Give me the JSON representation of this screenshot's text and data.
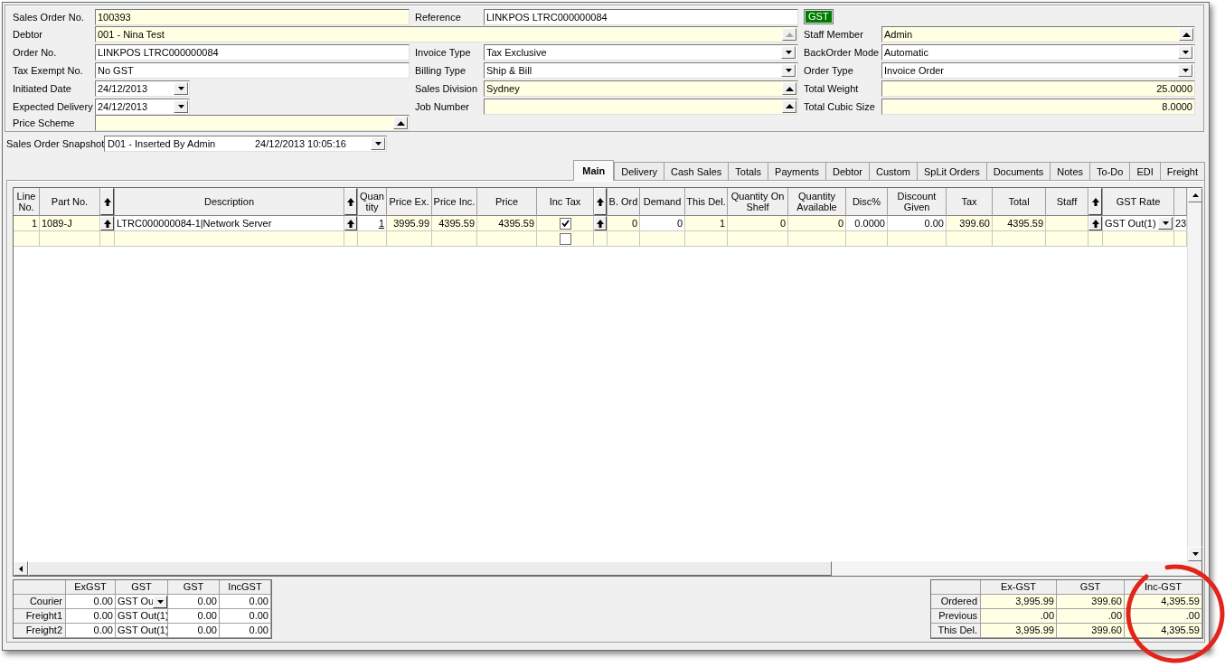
{
  "order_form": {
    "rows": [
      {
        "left": {
          "label": "Sales Order No.",
          "value": "100393",
          "kind": "text",
          "readonly": true
        },
        "middle": {
          "label": "Reference",
          "value": "LINKPOS LTRC000000084",
          "kind": "text",
          "readonly": false
        },
        "right": {
          "label": "GST",
          "kind": "badge"
        }
      },
      {
        "left": {
          "label": "Debtor",
          "value": "001 - Nina Test",
          "kind": "lookup",
          "readonly": true,
          "disabled": true
        },
        "right": {
          "label": "Staff Member",
          "value": "Admin",
          "kind": "lookup",
          "readonly": true,
          "disabled": false
        }
      },
      {
        "left": {
          "label": "Order No.",
          "value": "LINKPOS LTRC000000084",
          "kind": "text",
          "readonly": false
        },
        "middle": {
          "label": "Invoice Type",
          "value": "Tax Exclusive",
          "kind": "combo",
          "readonly": false
        },
        "right": {
          "label": "BackOrder Mode",
          "value": "Automatic",
          "kind": "combo",
          "readonly": false
        }
      },
      {
        "left": {
          "label": "Tax Exempt No.",
          "value": "No GST",
          "kind": "text",
          "readonly": false
        },
        "middle": {
          "label": "Billing Type",
          "value": "Ship & Bill",
          "kind": "combo",
          "readonly": false
        },
        "right": {
          "label": "Order Type",
          "value": "Invoice Order",
          "kind": "combo",
          "readonly": false
        }
      },
      {
        "left": {
          "label": "Initiated Date",
          "value": "24/12/2013",
          "kind": "date",
          "readonly": false
        },
        "middle": {
          "label": "Sales Division",
          "value": "Sydney",
          "kind": "lookup",
          "readonly": true,
          "disabled": false
        },
        "right": {
          "label": "Total Weight",
          "value": "25.0000",
          "kind": "number",
          "readonly": true
        }
      },
      {
        "left": {
          "label": "Expected Delivery",
          "value": "24/12/2013",
          "kind": "date",
          "readonly": false
        },
        "middle": {
          "label": "Job Number",
          "kind": "lookup",
          "readonly": true,
          "disabled": false
        },
        "right": {
          "label": "Total Cubic Size",
          "value": "8.0000",
          "kind": "number",
          "readonly": true
        }
      },
      {
        "left": {
          "label": "Price Scheme",
          "kind": "lookup",
          "readonly": true,
          "disabled": false
        }
      }
    ]
  },
  "snapshot": {
    "label": "Sales Order Snapshot",
    "value": "D01 - Inserted By Admin",
    "timestamp": "24/12/2013 10:05:16"
  },
  "tabs": [
    {
      "label": "Main",
      "selected": true
    },
    {
      "label": "Delivery",
      "selected": false
    },
    {
      "label": "Cash Sales",
      "selected": false
    },
    {
      "label": "Totals",
      "selected": false
    },
    {
      "label": "Payments",
      "selected": false
    },
    {
      "label": "Debtor",
      "selected": false
    },
    {
      "label": "Custom",
      "selected": false
    },
    {
      "label": "SpLit Orders",
      "selected": false
    },
    {
      "label": "Documents",
      "selected": false
    },
    {
      "label": "Notes",
      "selected": false
    },
    {
      "label": "To-Do",
      "selected": false
    },
    {
      "label": "EDI",
      "selected": false
    },
    {
      "label": "Freight",
      "selected": false
    }
  ],
  "order_lines": {
    "columns": [
      {
        "label": "Line No.",
        "kind": "number",
        "editable": false,
        "cells": [
          "1"
        ]
      },
      {
        "label": "Part No.",
        "kind": "text",
        "editable": false,
        "cells": [
          "1089-J"
        ]
      },
      {
        "kind": "button"
      },
      {
        "label": "Description",
        "kind": "text",
        "editable": true,
        "cells": [
          "LTRC000000084-1|Network Server"
        ]
      },
      {
        "kind": "button"
      },
      {
        "label": "Quantity",
        "kind": "link",
        "editable": true,
        "cells": [
          "1"
        ]
      },
      {
        "label": "Price Ex.",
        "kind": "number",
        "editable": false,
        "cells": [
          "3995.99"
        ]
      },
      {
        "label": "Price Inc.",
        "kind": "number",
        "editable": false,
        "cells": [
          "4395.59"
        ]
      },
      {
        "label": "Price",
        "kind": "number",
        "editable": false,
        "cells": [
          "4395.59"
        ]
      },
      {
        "label": "Inc Tax",
        "kind": "check",
        "editable": false
      },
      {
        "kind": "button"
      },
      {
        "label": "B. Ord",
        "kind": "number",
        "editable": false,
        "cells": [
          "0"
        ]
      },
      {
        "label": "Demand",
        "kind": "number",
        "editable": true,
        "cells": [
          "0"
        ]
      },
      {
        "label": "This Del.",
        "kind": "number",
        "editable": false,
        "cells": [
          "1"
        ]
      },
      {
        "label": "Quantity On Shelf",
        "kind": "number",
        "editable": false,
        "cells": [
          "0"
        ]
      },
      {
        "label": "Quantity Available",
        "kind": "number",
        "editable": false,
        "cells": [
          "0"
        ]
      },
      {
        "label": "Disc%",
        "kind": "number",
        "editable": true,
        "cells": [
          "0.0000"
        ]
      },
      {
        "label": "Discount Given",
        "kind": "number",
        "editable": true,
        "cells": [
          "0.00"
        ]
      },
      {
        "label": "Tax",
        "kind": "number",
        "editable": false,
        "cells": [
          "399.60"
        ]
      },
      {
        "label": "Total",
        "kind": "number",
        "editable": false,
        "cells": [
          "4395.59"
        ]
      },
      {
        "label": "Staff",
        "kind": "text",
        "editable": false
      },
      {
        "kind": "button"
      },
      {
        "label": "GST Rate",
        "kind": "combo",
        "editable": true,
        "cells": [
          "GST Out(1)"
        ]
      },
      {
        "kind": "text",
        "editable": true,
        "cells": [
          "23"
        ]
      }
    ],
    "rows": [
      {
        "kind": "line",
        "checked": true
      },
      {
        "kind": "blank",
        "checked": false
      }
    ]
  },
  "freight_charges": {
    "columns": [
      "ExGST",
      "GST",
      "GST",
      "IncGST"
    ],
    "rows": [
      {
        "label": "Courier",
        "selected": true,
        "cells": [
          "0.00",
          "GST Ou",
          "0.00",
          "0.00"
        ]
      },
      {
        "label": "Freight1",
        "selected": false,
        "cells": [
          "0.00",
          "GST Out(1)",
          "0.00",
          "0.00"
        ]
      },
      {
        "label": "Freight2",
        "selected": false,
        "cells": [
          "0.00",
          "GST Out(1)",
          "0.00",
          "0.00"
        ]
      }
    ]
  },
  "totals": {
    "columns": [
      "Ex-GST",
      "GST",
      "Inc-GST"
    ],
    "rows": [
      {
        "label": "Ordered",
        "cells": [
          "3,995.99",
          "399.60",
          "4,395.59"
        ]
      },
      {
        "label": "Previous",
        "cells": [
          ".00",
          ".00",
          ".00"
        ]
      },
      {
        "label": "This Del.",
        "cells": [
          "3,995.99",
          "399.60",
          "4,395.59"
        ]
      }
    ]
  },
  "annotations": [
    {
      "kind": "circle"
    }
  ]
}
